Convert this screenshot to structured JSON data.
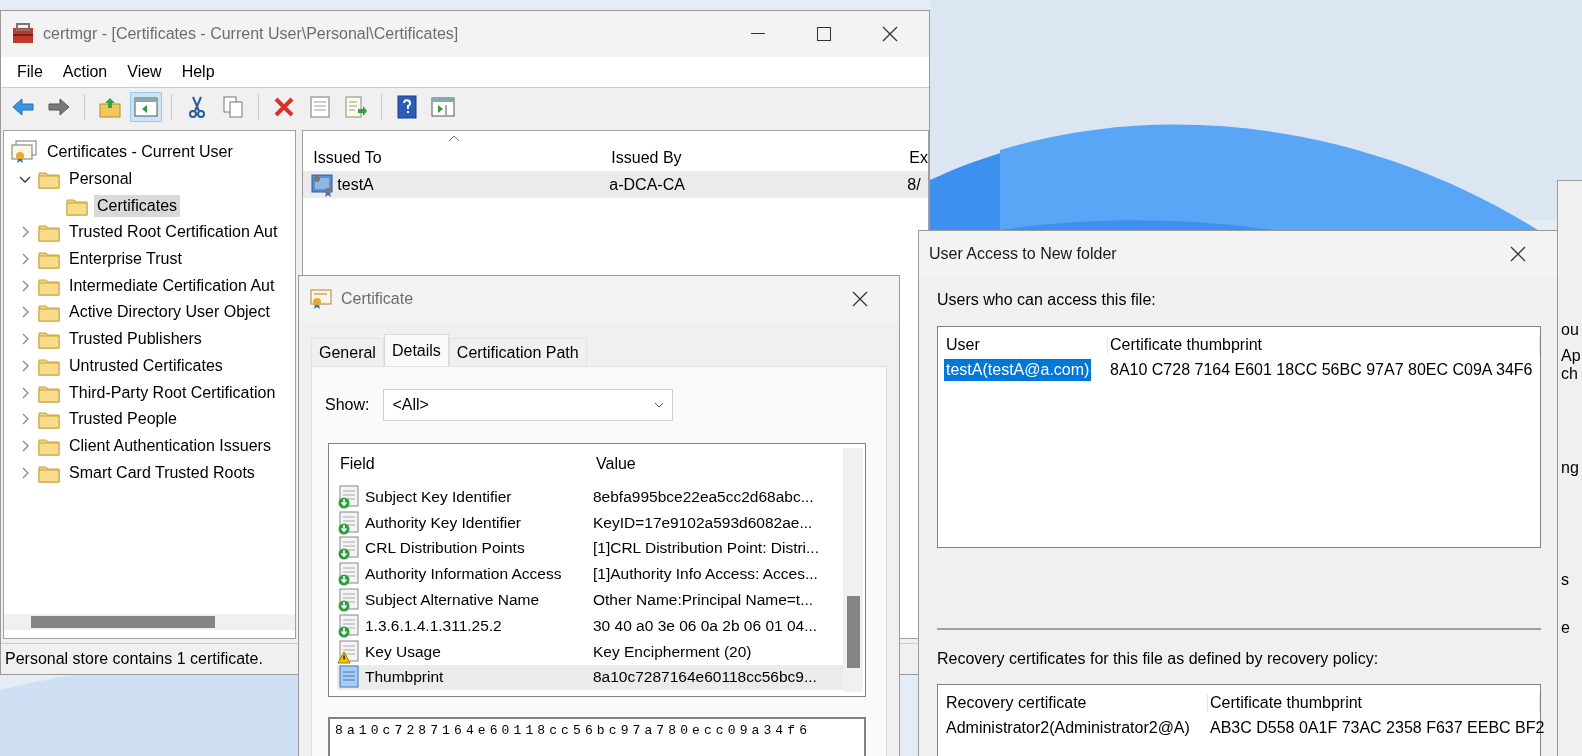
{
  "certmgr": {
    "title": "certmgr - [Certificates - Current User\\Personal\\Certificates]",
    "menu": [
      "File",
      "Action",
      "View",
      "Help"
    ],
    "toolbar": [
      {
        "kind": "back",
        "pressed": false
      },
      {
        "kind": "forward",
        "pressed": false
      },
      {
        "kind": "sep"
      },
      {
        "kind": "up",
        "pressed": false
      },
      {
        "kind": "tree",
        "pressed": true
      },
      {
        "kind": "sep"
      },
      {
        "kind": "cut",
        "pressed": false
      },
      {
        "kind": "copy",
        "pressed": false
      },
      {
        "kind": "sep"
      },
      {
        "kind": "delete",
        "pressed": false
      },
      {
        "kind": "properties",
        "pressed": false
      },
      {
        "kind": "export",
        "pressed": false
      },
      {
        "kind": "sep"
      },
      {
        "kind": "help",
        "pressed": false
      },
      {
        "kind": "pane",
        "pressed": false
      }
    ],
    "tree": {
      "label": "Certificates - Current User",
      "children": [
        {
          "label": "Personal",
          "expanded": true,
          "selected": false,
          "children": [
            {
              "label": "Certificates",
              "selected": true
            }
          ]
        },
        {
          "label": "Trusted Root Certification Aut",
          "expanded": false,
          "selected": false
        },
        {
          "label": "Enterprise Trust",
          "expanded": false,
          "selected": false
        },
        {
          "label": "Intermediate Certification Aut",
          "expanded": false,
          "selected": false
        },
        {
          "label": "Active Directory User Object",
          "expanded": false,
          "selected": false
        },
        {
          "label": "Trusted Publishers",
          "expanded": false,
          "selected": false
        },
        {
          "label": "Untrusted Certificates",
          "expanded": false,
          "selected": false
        },
        {
          "label": "Third-Party Root Certification",
          "expanded": false,
          "selected": false
        },
        {
          "label": "Trusted People",
          "expanded": false,
          "selected": false
        },
        {
          "label": "Client Authentication Issuers",
          "expanded": false,
          "selected": false
        },
        {
          "label": "Smart Card Trusted Roots",
          "expanded": false,
          "selected": false
        }
      ]
    },
    "list": {
      "columns": [
        "Issued To",
        "Issued By",
        "Ex"
      ],
      "rows": [
        {
          "cells": [
            "testA",
            "a-DCA-CA",
            "8/"
          ],
          "selected": true
        }
      ]
    },
    "status": "Personal store contains 1 certificate."
  },
  "certificate_dialog": {
    "title": "Certificate",
    "tabs": [
      {
        "label": "General",
        "selected": false
      },
      {
        "label": "Details",
        "selected": true
      },
      {
        "label": "Certification Path",
        "selected": false
      }
    ],
    "show_label": "Show:",
    "show_value": "<All>",
    "columns": [
      "Field",
      "Value"
    ],
    "rows": [
      {
        "kind": "extension",
        "field": "Subject Key Identifier",
        "value": "8ebfa995bce22ea5cc2d68abc...",
        "selected": false
      },
      {
        "kind": "extension",
        "field": "Authority Key Identifier",
        "value": "KeyID=17e9102a593d6082ae...",
        "selected": false
      },
      {
        "kind": "extension",
        "field": "CRL Distribution Points",
        "value": "[1]CRL Distribution Point: Distri...",
        "selected": false
      },
      {
        "kind": "extension",
        "field": "Authority Information Access",
        "value": "[1]Authority Info Access: Acces...",
        "selected": false
      },
      {
        "kind": "extension",
        "field": "Subject Alternative Name",
        "value": "Other Name:Principal Name=t...",
        "selected": false
      },
      {
        "kind": "extension",
        "field": "1.3.6.1.4.1.311.25.2",
        "value": "30 40 a0 3e 06 0a 2b 06 01 04...",
        "selected": false
      },
      {
        "kind": "critical",
        "field": "Key Usage",
        "value": "Key Encipherment (20)",
        "selected": false
      },
      {
        "kind": "property",
        "field": "Thumbprint",
        "value": "8a10c7287164e60118cc56bc9...",
        "selected": true
      }
    ],
    "detail": "8a10c7287164e60118cc56bc97a780ecc09a34f6"
  },
  "access_dialog": {
    "title": "User Access to New folder",
    "users_label": "Users who can access this file:",
    "users_columns": [
      "User",
      "Certificate thumbprint"
    ],
    "users": [
      {
        "cells": [
          "testA(testA@a.com)",
          "8A10 C728 7164 E601 18CC 56BC 97A7 80EC C09A 34F6"
        ],
        "selected": true
      }
    ],
    "recovery_label": "Recovery certificates for this file as defined by recovery policy:",
    "recovery_columns": [
      "Recovery certificate",
      "Certificate thumbprint"
    ],
    "recovery": [
      {
        "cells": [
          "Administrator2(Administrator2@A)",
          "AB3C D558 0A1F 73AC 2358 F637 EEBC BF2"
        ],
        "selected": false
      }
    ]
  },
  "background_window": {
    "texts": [
      "ou",
      "Ap",
      "ch",
      "ng",
      "s",
      "e"
    ]
  }
}
